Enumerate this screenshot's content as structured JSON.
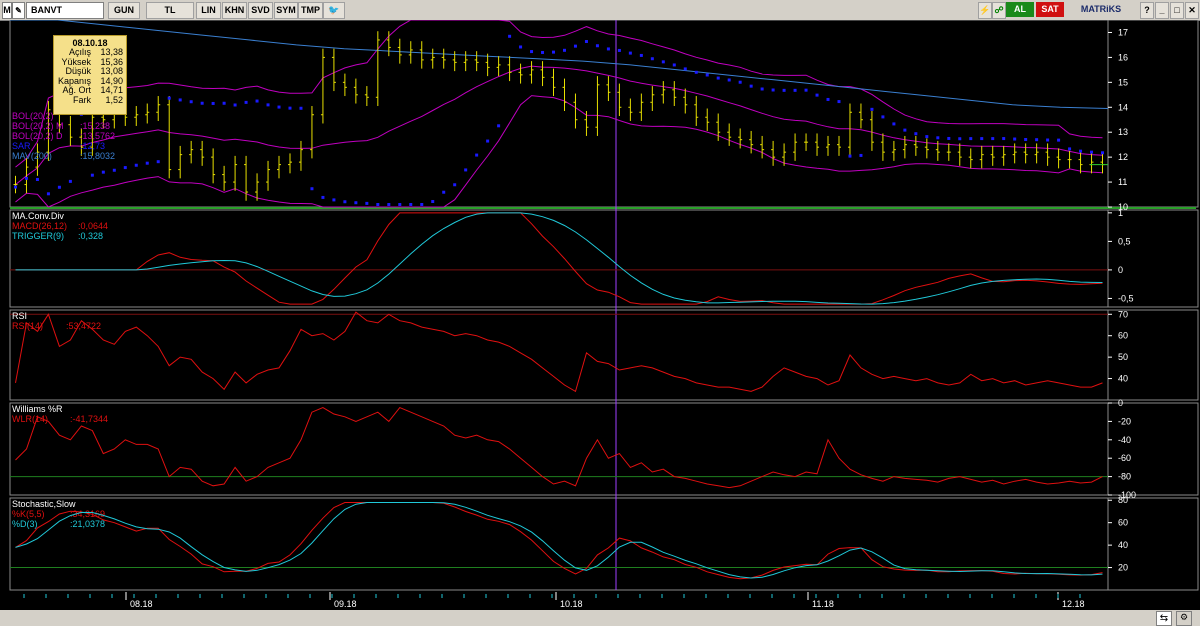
{
  "toolbar": {
    "symbol_prefix": "M",
    "symbol": "BANVT",
    "period": "GUN",
    "currency": "TL",
    "buttons": [
      "LIN",
      "KHN",
      "SVD",
      "SYM",
      "TMP"
    ],
    "al": "AL",
    "sat": "SAT",
    "brand": "MATRiKS"
  },
  "infobox": {
    "date": "08.10.18",
    "rows": [
      {
        "label": "Açılış",
        "value": "13,38"
      },
      {
        "label": "Yüksek",
        "value": "15,36"
      },
      {
        "label": "Düşük",
        "value": "13,08"
      },
      {
        "label": "Kapanış",
        "value": "14,90"
      },
      {
        "label": "Ağ. Ort",
        "value": "14,71"
      },
      {
        "label": "Fark",
        "value": "1,52"
      }
    ]
  },
  "colors": {
    "price_bar": "#e8e000",
    "bollinger": "#c000c0",
    "sar": "#1a1aff",
    "mav": "#3a7fd0",
    "macd": "#e01010",
    "trigger": "#20c8d8",
    "rsi": "#e01010",
    "williams": "#e01010",
    "stoch_k": "#e01010",
    "stoch_d": "#20c8d8",
    "vline": "#a040ff",
    "hline_green": "#1f7f1f"
  },
  "chart_data": [
    {
      "type": "line",
      "panel": "price",
      "legend": [
        {
          "label": "BOL(20,2) ",
          "value": "",
          "color": "#c000c0"
        },
        {
          "label": "BOL(20,2) M",
          "value": ":15,238",
          "color": "#c000c0"
        },
        {
          "label": "BOL(20,2) D",
          "value": ":13,5762",
          "color": "#c000c0"
        },
        {
          "label": "SAR",
          "value": ":12,73",
          "color": "#1a1aff"
        },
        {
          "label": "MAV(200)",
          "value": ":15,8032",
          "color": "#3a7fd0"
        }
      ],
      "ylim": [
        10,
        17.5
      ],
      "yticks": [
        "10",
        "11",
        "12",
        "13",
        "14",
        "15",
        "16",
        "17"
      ],
      "xticks": [
        "08.18",
        "09.18",
        "10.18",
        "11.18",
        "12.18"
      ],
      "closes": [
        10.9,
        11.6,
        12.2,
        13.9,
        13.3,
        12.8,
        12.4,
        13.6,
        13.5,
        13.9,
        13.6,
        13.7,
        13.8,
        14.1,
        11.5,
        12.1,
        12.3,
        12.0,
        11.3,
        11.0,
        11.7,
        10.6,
        11.0,
        11.5,
        11.7,
        11.8,
        12.3,
        13.7,
        16.0,
        15.0,
        14.8,
        14.5,
        14.4,
        16.7,
        16.4,
        16.1,
        16.3,
        15.9,
        16.0,
        15.9,
        15.8,
        15.9,
        15.8,
        15.6,
        15.7,
        15.4,
        15.3,
        15.5,
        15.2,
        14.8,
        14.2,
        13.5,
        13.2,
        14.9,
        14.6,
        14.0,
        13.8,
        14.2,
        14.5,
        14.7,
        14.4,
        14.1,
        13.6,
        13.4,
        13.0,
        12.8,
        12.7,
        12.5,
        12.3,
        12.0,
        12.2,
        12.6,
        12.6,
        12.4,
        12.5,
        12.4,
        13.8,
        13.5,
        12.6,
        12.2,
        12.3,
        12.5,
        12.4,
        12.3,
        12.2,
        12.2,
        12.0,
        11.9,
        12.1,
        12.0,
        12.1,
        12.2,
        12.1,
        12.2,
        12.0,
        11.9,
        11.9,
        11.7,
        11.8,
        11.7
      ],
      "mav200": [
        17.6,
        17.5,
        17.3,
        17.1,
        16.9,
        16.7,
        16.5,
        16.35,
        16.25,
        16.15,
        16.05,
        15.95,
        15.85,
        15.7,
        15.5,
        15.3,
        15.1,
        14.9,
        14.7,
        14.5,
        14.3,
        14.1,
        14.0,
        13.95
      ],
      "sar_last": 12.73
    },
    {
      "type": "line",
      "panel": "macd",
      "title": "MA.Conv.Div",
      "series": [
        {
          "name": "MACD(26,12)",
          "last": "0,0644"
        },
        {
          "name": "TRIGGER(9)",
          "last": "0,328"
        }
      ],
      "yticks": [
        "1",
        "0,5",
        "0",
        "-0,5"
      ],
      "ylim": [
        -0.65,
        1.05
      ]
    },
    {
      "type": "line",
      "panel": "rsi",
      "title": "RSI",
      "series": [
        {
          "name": "RSI(14)",
          "last": "53,4722"
        }
      ],
      "values": [
        38,
        66,
        62,
        70,
        55,
        58,
        67,
        63,
        58,
        56,
        62,
        64,
        60,
        55,
        46,
        50,
        49,
        43,
        40,
        35,
        43,
        38,
        42,
        44,
        45,
        53,
        63,
        60,
        61,
        58,
        62,
        71,
        67,
        66,
        70,
        67,
        66,
        64,
        63,
        62,
        60,
        61,
        60,
        58,
        57,
        55,
        52,
        49,
        45,
        41,
        37,
        34,
        52,
        48,
        47,
        44,
        45,
        46,
        45,
        43,
        41,
        40,
        38,
        37,
        36,
        36,
        35,
        34,
        36,
        41,
        45,
        43,
        41,
        40,
        37,
        39,
        51,
        45,
        42,
        40,
        41,
        40,
        39,
        40,
        38,
        37,
        38,
        42,
        39,
        40,
        38,
        39,
        37,
        38,
        39,
        38,
        37,
        36,
        36,
        38
      ],
      "yticks": [
        "70",
        "60",
        "50",
        "40"
      ],
      "ylim": [
        30,
        72
      ]
    },
    {
      "type": "line",
      "panel": "williams",
      "title": "Williams %R",
      "series": [
        {
          "name": "WLR(14)",
          "last": "-41,7344"
        }
      ],
      "values": [
        -62,
        -50,
        -15,
        -20,
        -35,
        -40,
        -25,
        -30,
        -55,
        -50,
        -40,
        -45,
        -45,
        -50,
        -80,
        -70,
        -72,
        -85,
        -90,
        -88,
        -70,
        -85,
        -80,
        -70,
        -65,
        -60,
        -40,
        -10,
        -5,
        -12,
        -15,
        -20,
        -15,
        -10,
        -20,
        -5,
        -10,
        -15,
        -20,
        -25,
        -35,
        -38,
        -35,
        -40,
        -42,
        -50,
        -60,
        -70,
        -80,
        -88,
        -85,
        -90,
        -60,
        -40,
        -60,
        -55,
        -70,
        -65,
        -75,
        -72,
        -80,
        -82,
        -85,
        -88,
        -90,
        -92,
        -90,
        -85,
        -80,
        -75,
        -78,
        -80,
        -75,
        -77,
        -40,
        -60,
        -72,
        -78,
        -82,
        -85,
        -80,
        -82,
        -83,
        -84,
        -86,
        -82,
        -80,
        -83,
        -86,
        -84,
        -88,
        -85,
        -83,
        -86,
        -88,
        -87,
        -85,
        -87,
        -86,
        -80
      ],
      "yticks": [
        "0",
        "-20",
        "-40",
        "-60",
        "-80",
        "-100"
      ],
      "ylim": [
        -100,
        0
      ]
    },
    {
      "type": "line",
      "panel": "stochastic",
      "title": "Stochastic,Slow",
      "series": [
        {
          "name": "%K(5,5)",
          "last": "34,3169"
        },
        {
          "name": "%D(3)",
          "last": "21,0378"
        }
      ],
      "yticks": [
        "80",
        "60",
        "40",
        "20"
      ],
      "ylim": [
        0,
        82
      ]
    }
  ]
}
